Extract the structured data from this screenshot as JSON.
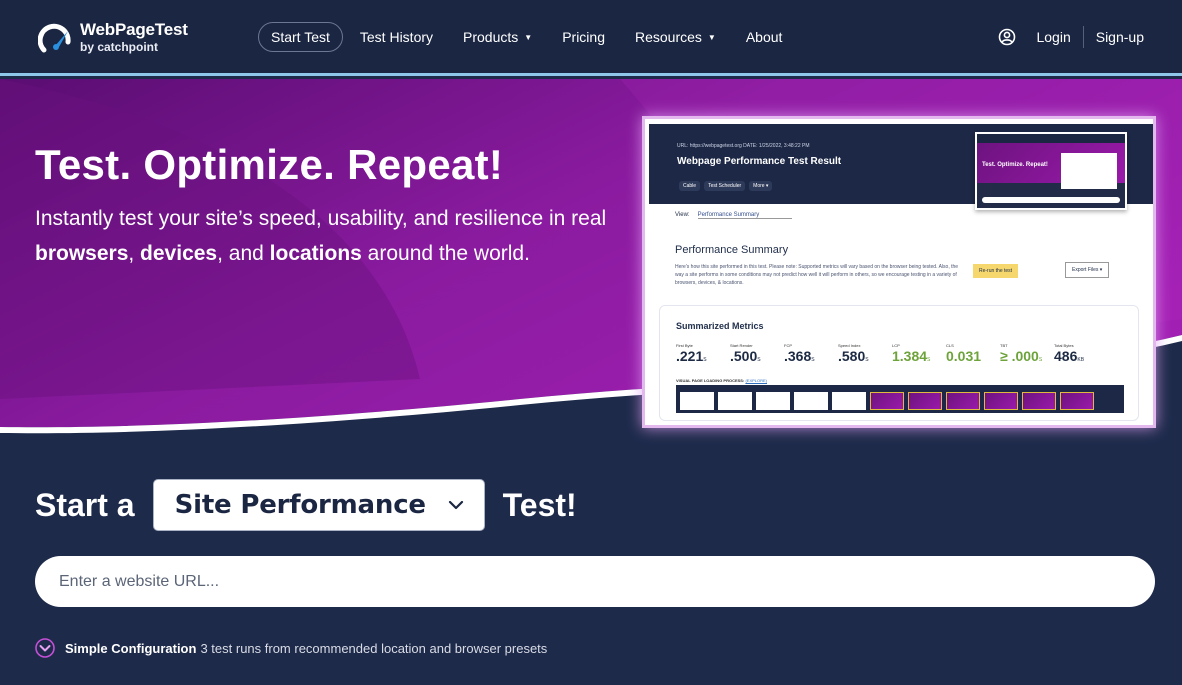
{
  "brand": {
    "title": "WebPageTest",
    "subtitle": "by catchpoint"
  },
  "nav": {
    "items": [
      {
        "label": "Start Test",
        "active": true
      },
      {
        "label": "Test History"
      },
      {
        "label": "Products",
        "dropdown": true
      },
      {
        "label": "Pricing"
      },
      {
        "label": "Resources",
        "dropdown": true
      },
      {
        "label": "About"
      }
    ],
    "login": "Login",
    "signup": "Sign-up"
  },
  "hero": {
    "title": "Test. Optimize. Repeat!",
    "desc_1": "Instantly test your site’s speed, usability, and resilience in real ",
    "bold_1": "browsers",
    "sep_1": ", ",
    "bold_2": "devices",
    "sep_2": ", and ",
    "bold_3": "locations",
    "desc_2": " around the world."
  },
  "preview": {
    "url": "URL: https://webpagetest.org     DATE: 1/25/2022, 3:48:22 PM",
    "title": "Webpage Performance Test Result",
    "chips": [
      "Cable",
      "Test Scheduler",
      "More ▾"
    ],
    "mini_text": "Test. Optimize. Repeat!",
    "view_label": "View:",
    "view_value": "Performance Summary",
    "summary_title": "Performance Summary",
    "summary_note": "Here's how this site performed in this test. Please note: Supported metrics will vary based on the browser being tested. Also, the way a site performs in some conditions may not predict how well it will perform in others, so we encourage testing in a variety of browsers, devices, & locations.",
    "rerun": "Re-run the test",
    "export": "Export Files ▾",
    "metrics_title": "Summarized Metrics",
    "metrics": [
      {
        "label": "First Byte",
        "value": ".221",
        "unit": "S"
      },
      {
        "label": "Start Render",
        "value": ".500",
        "unit": "S"
      },
      {
        "label": "FCP",
        "value": ".368",
        "unit": "S"
      },
      {
        "label": "Speed Index",
        "value": ".580",
        "unit": "S"
      },
      {
        "label": "LCP",
        "value": "1.384",
        "unit": "S",
        "good": true
      },
      {
        "label": "CLS",
        "value": "0.031",
        "unit": "",
        "good": true
      },
      {
        "label": "TBT",
        "value": "≥ .000",
        "unit": "S",
        "good": true
      },
      {
        "label": "Total Bytes",
        "value": "486",
        "unit": "KB"
      }
    ],
    "visual_label": "VISUAL PAGE LOADING PROCESS:",
    "visual_link": "(EXPLORE)"
  },
  "start_test": {
    "prefix": "Start a",
    "selected": "Site Performance",
    "suffix": "Test!"
  },
  "url_input": {
    "placeholder": "Enter a website URL...",
    "value": ""
  },
  "config": {
    "title": "Simple Configuration",
    "desc": "3 test runs from recommended location and browser presets"
  },
  "colors": {
    "navy": "#1d2a4a",
    "header": "#1b2642",
    "purple": "#8b1a9e",
    "accent": "#8ec7ea",
    "good_metric": "#6da33a"
  }
}
